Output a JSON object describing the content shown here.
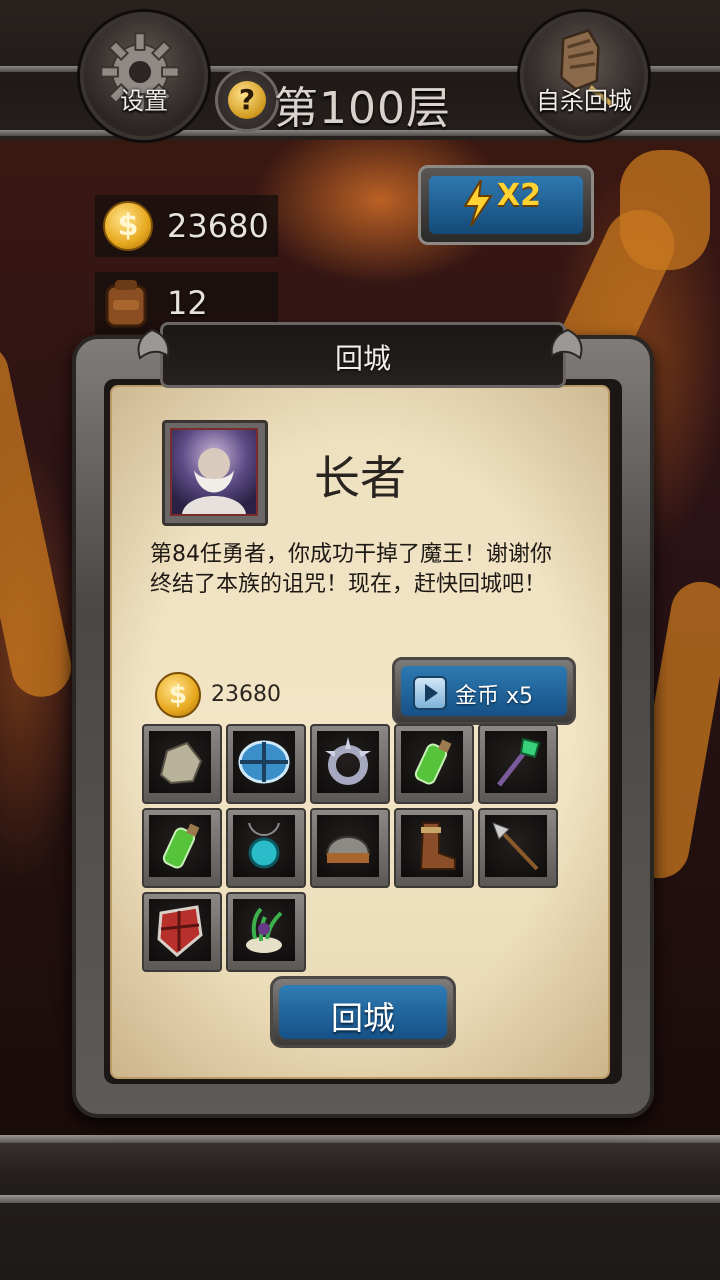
{
  "header": {
    "settings_label": "设置",
    "floor_title": "第100层",
    "help_icon_glyph": "?",
    "suicide_return_label": "自杀回城"
  },
  "stats": {
    "gold": "23680",
    "bag": "12",
    "speed_label": "X2"
  },
  "dialog": {
    "title": "回城",
    "npc_name": "长者",
    "message": "第84任勇者，你成功干掉了魔王！谢谢你终结了本族的诅咒！现在，赶快回城吧！",
    "reward_gold": "23680",
    "coin_symbol": "$",
    "ad_button_label": "金币 x5",
    "return_button_label": "回城",
    "items": [
      {
        "icon": "ore-chunk-icon"
      },
      {
        "icon": "blue-shield-icon"
      },
      {
        "icon": "spiked-ring-icon"
      },
      {
        "icon": "green-potion-icon"
      },
      {
        "icon": "emerald-staff-icon"
      },
      {
        "icon": "green-potion-icon"
      },
      {
        "icon": "turquoise-amulet-icon"
      },
      {
        "icon": "iron-helmet-icon"
      },
      {
        "icon": "leather-boot-icon"
      },
      {
        "icon": "spear-icon"
      },
      {
        "icon": "red-shield-icon"
      },
      {
        "icon": "herb-bundle-icon"
      }
    ]
  },
  "colors": {
    "accent_blue": "#2d7ab2",
    "gold": "#e7a81e",
    "parchment": "#f2e5c6",
    "lightning": "#ffd232"
  }
}
